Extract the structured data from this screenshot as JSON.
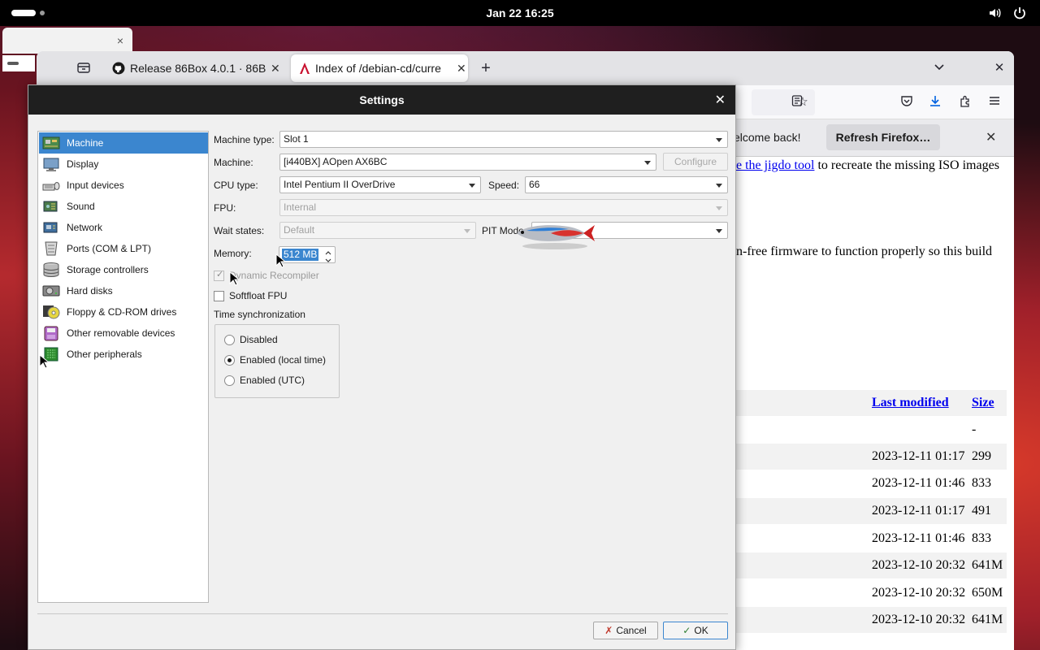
{
  "topbar": {
    "clock": "Jan 22  16:25",
    "icons": [
      "volume-icon",
      "power-icon"
    ]
  },
  "ghost_window": {
    "close_glyph": "×"
  },
  "firefox": {
    "tabs": [
      {
        "label": "Release 86Box 4.0.1 · 86B",
        "icon": "github-icon"
      },
      {
        "label": "Index of /debian-cd/curre",
        "icon": "debian-icon"
      }
    ],
    "notification": {
      "welcome": "elcome back!",
      "refresh_button": "Refresh Firefox…"
    },
    "content": {
      "line1_link": "e the jigdo tool",
      "line1_text": " to recreate the missing ISO images",
      "line2_text": "n-free firmware to function properly so this build"
    },
    "table": {
      "headers": {
        "last_modified": "Last modified",
        "size": "Size"
      },
      "rows": [
        {
          "date": "",
          "size": "-"
        },
        {
          "date": "2023-12-11 01:17",
          "size": "299"
        },
        {
          "date": "2023-12-11 01:46",
          "size": "833"
        },
        {
          "date": "2023-12-11 01:17",
          "size": "491"
        },
        {
          "date": "2023-12-11 01:46",
          "size": "833"
        },
        {
          "date": "2023-12-10 20:32",
          "size": "641M"
        },
        {
          "date": "2023-12-10 20:32",
          "size": "650M"
        },
        {
          "date": "2023-12-10 20:32",
          "size": "641M"
        }
      ]
    }
  },
  "dialog": {
    "title": "Settings",
    "categories": [
      {
        "label": "Machine",
        "icon": "machine-icon"
      },
      {
        "label": "Display",
        "icon": "display-icon"
      },
      {
        "label": "Input devices",
        "icon": "input-devices-icon"
      },
      {
        "label": "Sound",
        "icon": "sound-icon"
      },
      {
        "label": "Network",
        "icon": "network-icon"
      },
      {
        "label": "Ports (COM & LPT)",
        "icon": "ports-icon"
      },
      {
        "label": "Storage controllers",
        "icon": "storage-icon"
      },
      {
        "label": "Hard disks",
        "icon": "hard-disk-icon"
      },
      {
        "label": "Floppy & CD-ROM drives",
        "icon": "floppy-cdrom-icon"
      },
      {
        "label": "Other removable devices",
        "icon": "removable-icon"
      },
      {
        "label": "Other peripherals",
        "icon": "peripherals-icon"
      }
    ],
    "selected_category": "Machine",
    "fields": {
      "machine_type_label": "Machine type:",
      "machine_type_value": "Slot 1",
      "machine_label": "Machine:",
      "machine_value": "[i440BX] AOpen AX6BC",
      "configure_button": "Configure",
      "cpu_type_label": "CPU type:",
      "cpu_type_value": "Intel Pentium II OverDrive",
      "speed_label": "Speed:",
      "speed_value": "66",
      "fpu_label": "FPU:",
      "fpu_value": "Internal",
      "wait_states_label": "Wait states:",
      "wait_states_value": "Default",
      "pit_mode_label": "PIT Mode:",
      "pit_mode_value": "",
      "memory_label": "Memory:",
      "memory_value": "512 MB",
      "dynarec_label": "Dynamic Recompiler",
      "dynarec_checked": true,
      "softfloat_label": "Softfloat FPU",
      "softfloat_checked": false,
      "time_sync_label": "Time synchronization",
      "time_sync_options": [
        "Disabled",
        "Enabled (local time)",
        "Enabled (UTC)"
      ],
      "time_sync_selected": "Enabled (local time)"
    },
    "buttons": {
      "cancel": "Cancel",
      "ok": "OK"
    }
  }
}
